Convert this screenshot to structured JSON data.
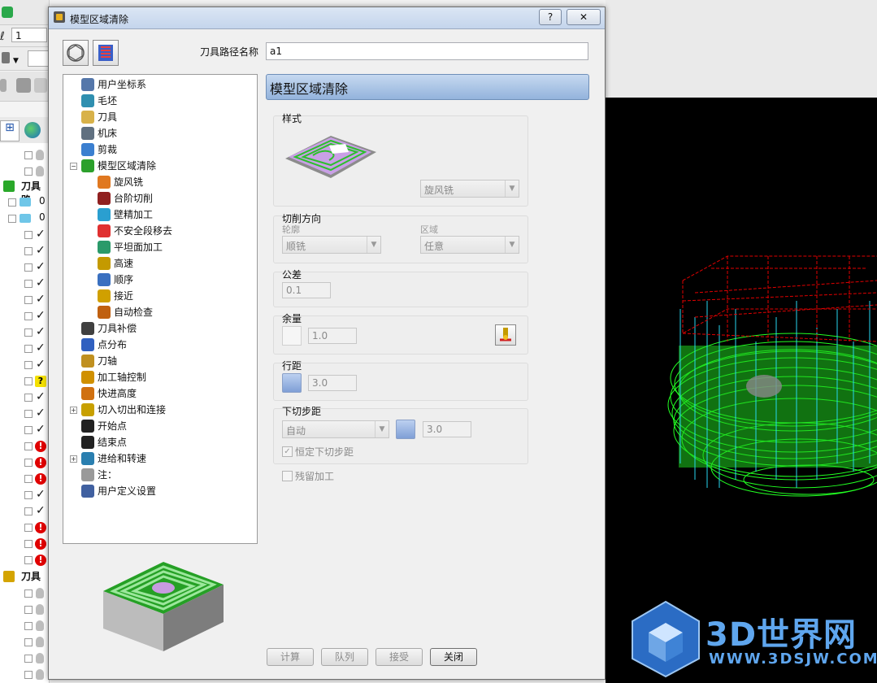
{
  "dialog": {
    "title": "模型区域清除",
    "help_button": "?",
    "close_button": "✕",
    "path_name_label": "刀具路径名称",
    "path_name_value": "a1",
    "page_header": "模型区域清除",
    "tree": [
      {
        "label": "用户坐标系",
        "icon": "ucs-icon",
        "indent": 0,
        "expander": ""
      },
      {
        "label": "毛坯",
        "icon": "block-icon",
        "indent": 0,
        "expander": ""
      },
      {
        "label": "刀具",
        "icon": "tool-icon",
        "indent": 0,
        "expander": ""
      },
      {
        "label": "机床",
        "icon": "machine-icon",
        "indent": 0,
        "expander": ""
      },
      {
        "label": "剪裁",
        "icon": "trim-icon",
        "indent": 0,
        "expander": ""
      },
      {
        "label": "模型区域清除",
        "icon": "area-clear-icon",
        "indent": 0,
        "expander": "−"
      },
      {
        "label": "旋风铣",
        "icon": "vortex-icon",
        "indent": 1,
        "expander": ""
      },
      {
        "label": "台阶切削",
        "icon": "step-cut-icon",
        "indent": 1,
        "expander": ""
      },
      {
        "label": "壁精加工",
        "icon": "wall-finish-icon",
        "indent": 1,
        "expander": ""
      },
      {
        "label": "不安全段移去",
        "icon": "unsafe-remove-icon",
        "indent": 1,
        "expander": ""
      },
      {
        "label": "平坦面加工",
        "icon": "flat-icon",
        "indent": 1,
        "expander": ""
      },
      {
        "label": "高速",
        "icon": "high-speed-icon",
        "indent": 1,
        "expander": ""
      },
      {
        "label": "顺序",
        "icon": "order-icon",
        "indent": 1,
        "expander": ""
      },
      {
        "label": "接近",
        "icon": "approach-icon",
        "indent": 1,
        "expander": ""
      },
      {
        "label": "自动检查",
        "icon": "auto-check-icon",
        "indent": 1,
        "expander": ""
      },
      {
        "label": "刀具补偿",
        "icon": "tool-comp-icon",
        "indent": 0,
        "expander": ""
      },
      {
        "label": "点分布",
        "icon": "point-dist-icon",
        "indent": 0,
        "expander": ""
      },
      {
        "label": "刀轴",
        "icon": "tool-axis-icon",
        "indent": 0,
        "expander": ""
      },
      {
        "label": "加工轴控制",
        "icon": "axis-control-icon",
        "indent": 0,
        "expander": ""
      },
      {
        "label": "快进高度",
        "icon": "rapid-height-icon",
        "indent": 0,
        "expander": ""
      },
      {
        "label": "切入切出和连接",
        "icon": "leads-links-icon",
        "indent": 0,
        "expander": "+"
      },
      {
        "label": "开始点",
        "icon": "start-point-icon",
        "indent": 0,
        "expander": ""
      },
      {
        "label": "结束点",
        "icon": "end-point-icon",
        "indent": 0,
        "expander": ""
      },
      {
        "label": "进给和转速",
        "icon": "feed-speed-icon",
        "indent": 0,
        "expander": "+"
      },
      {
        "label": "注：",
        "icon": "note-icon",
        "indent": 0,
        "expander": ""
      },
      {
        "label": "用户定义设置",
        "icon": "user-settings-icon",
        "indent": 0,
        "expander": ""
      }
    ],
    "style_group": {
      "label": "样式",
      "value": "旋风铣"
    },
    "cut_direction": {
      "label": "切削方向",
      "profile_label": "轮廓",
      "profile_value": "顺铣",
      "area_label": "区域",
      "area_value": "任意"
    },
    "tolerance": {
      "label": "公差",
      "value": "0.1"
    },
    "thickness": {
      "label": "余量",
      "value": "1.0"
    },
    "stepover": {
      "label": "行距",
      "value": "3.0"
    },
    "stepdown": {
      "label": "下切步距",
      "mode": "自动",
      "value": "3.0",
      "constant_label": "恒定下切步距",
      "constant_checked": true
    },
    "rest_machining": {
      "label": "残留加工",
      "checked": false
    },
    "buttons": {
      "calculate": "计算",
      "queue": "队列",
      "accept": "接受",
      "close": "关闭"
    }
  },
  "background_app": {
    "field_value": "1",
    "toolpaths_label": "刀具路",
    "tools_label": "刀具",
    "folder_count_1": "0",
    "folder_count_2": "0"
  },
  "watermark": {
    "brand": "3D世界网",
    "url": "WWW.3DSJW.COM"
  },
  "colors": {
    "accent": "#3a78c8",
    "header": "#a9c4e4",
    "toolpath_green": "#22ff22",
    "toolpath_red": "#e00000",
    "toolpath_cyan": "#27d6f0"
  }
}
